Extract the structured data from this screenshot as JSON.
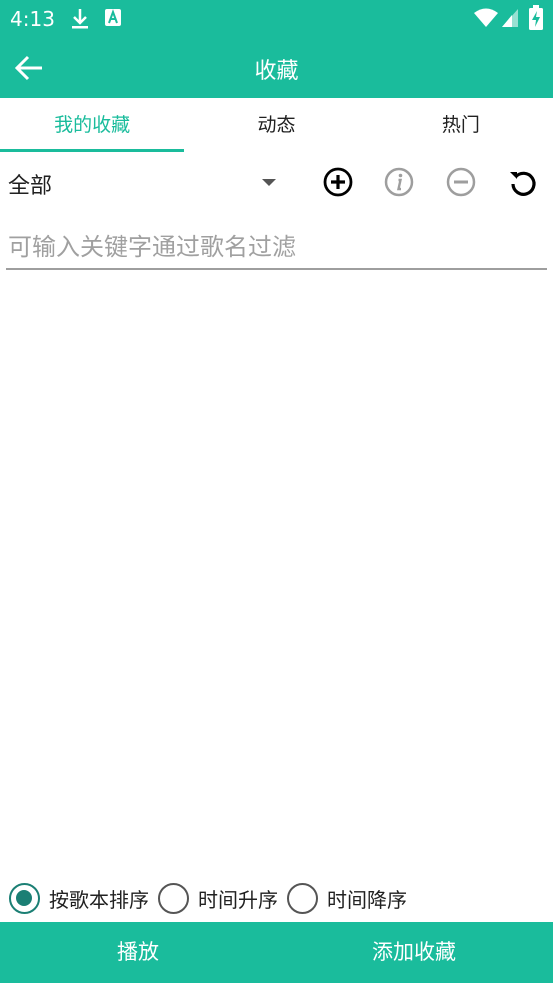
{
  "status_bar": {
    "time": "4:13",
    "icons": [
      "download-icon",
      "app-notification-icon",
      "wifi-icon",
      "cellular-signal-icon",
      "battery-charging-icon"
    ]
  },
  "app_bar": {
    "title": "收藏",
    "back_icon": "arrow-left-icon"
  },
  "tabs": [
    {
      "label": "我的收藏",
      "active": true
    },
    {
      "label": "动态",
      "active": false
    },
    {
      "label": "热门",
      "active": false
    }
  ],
  "toolbar": {
    "dropdown_value": "全部",
    "buttons": [
      "add-circle-icon",
      "info-icon",
      "remove-circle-icon",
      "refresh-icon"
    ]
  },
  "search": {
    "value": "",
    "placeholder": "可输入关键字通过歌名过滤"
  },
  "sort": {
    "options": [
      {
        "label": "按歌本排序",
        "checked": true
      },
      {
        "label": "时间升序",
        "checked": false
      },
      {
        "label": "时间降序",
        "checked": false
      }
    ]
  },
  "bottom_bar": {
    "play_label": "播放",
    "add_favorite_label": "添加收藏"
  },
  "colors": {
    "primary": "#1abc9c",
    "radio_checked": "#1b7f74"
  }
}
